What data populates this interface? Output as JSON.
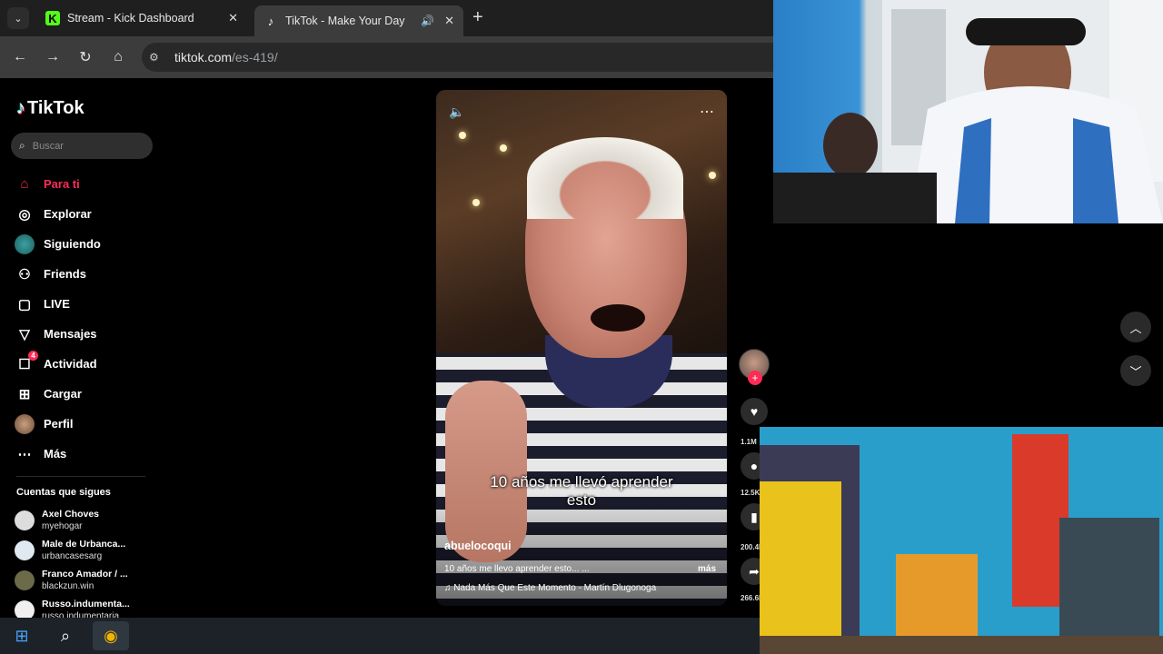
{
  "browser": {
    "tabs": [
      {
        "title": "Stream - Kick Dashboard",
        "favicon": "K",
        "active": false
      },
      {
        "title": "TikTok - Make Your Day",
        "favicon": "♪",
        "active": true
      }
    ],
    "url_host": "tiktok.com",
    "url_path": "/es-419/"
  },
  "tiktok": {
    "logo_text": "TikTok",
    "search_placeholder": "Buscar",
    "nav": [
      {
        "label": "Para ti",
        "icon": "home-icon"
      },
      {
        "label": "Explorar",
        "icon": "compass-icon"
      },
      {
        "label": "Siguiendo",
        "icon": "following-avatar"
      },
      {
        "label": "Friends",
        "icon": "friends-icon"
      },
      {
        "label": "LIVE",
        "icon": "live-icon"
      },
      {
        "label": "Mensajes",
        "icon": "messages-icon"
      },
      {
        "label": "Actividad",
        "icon": "activity-icon",
        "badge": "4"
      },
      {
        "label": "Cargar",
        "icon": "upload-icon"
      },
      {
        "label": "Perfil",
        "icon": "profile-avatar"
      },
      {
        "label": "Más",
        "icon": "more-icon"
      }
    ],
    "following_title": "Cuentas que sigues",
    "following": [
      {
        "name": "Axel Choves",
        "handle": "myehogar"
      },
      {
        "name": "Male de Urbanca...",
        "handle": "urbancasesarg"
      },
      {
        "name": "Franco Amador / ...",
        "handle": "blackzun.win"
      },
      {
        "name": "Russo.indumenta...",
        "handle": "russo.indumentaria"
      }
    ],
    "video": {
      "caption_line1": "10 años me llevó aprender",
      "caption_line2": "esto",
      "author": "abuelocoqui",
      "description": "10 años me llevo aprender esto... ...",
      "more": "más",
      "music": "Nada Más Que Este Momento - Martín Dlugonoga"
    },
    "actions": {
      "likes": "1.1M",
      "comments": "12.5K",
      "saves": "200.4K",
      "shares": "266.6K"
    }
  },
  "colors": {
    "accent": "#fe2c55",
    "chrome_dark": "#1f1f1f",
    "chrome_toolbar": "#3c3c3c"
  }
}
